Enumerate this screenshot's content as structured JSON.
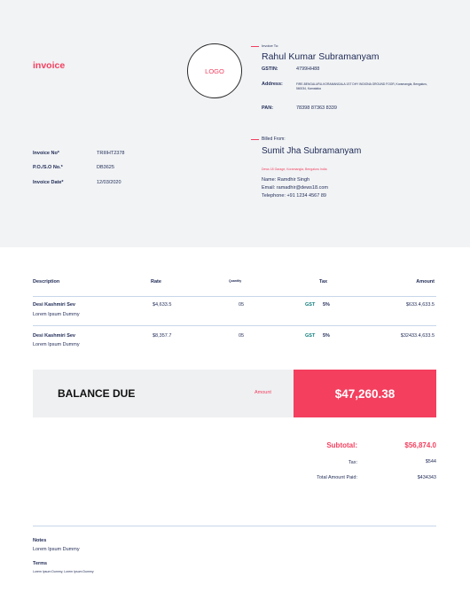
{
  "header": {
    "title": "invoice",
    "logo_text": "LOGO",
    "invoice_to": {
      "label": "Invoice To:",
      "name": "Rahul Kumar Subramanyam",
      "gstin_label": "GSTIN:",
      "gstin_value": "4799HH88",
      "address_label": "Address:",
      "address_value": "FIRE-BENGALURU-KORAMANGALA 1ST DHY INDIONA GROUND FOOR, Koramangla, Bengaluru, 560034, Karnataka",
      "pan_label": "PAN:",
      "pan_value": "78398 87363 8339"
    },
    "billed_from": {
      "label": "Billed From:",
      "name": "Sumit Jha Subramanyam",
      "address": "Dews 18 Garage, Koramangla, Bengaluru India",
      "contact_name": "Name: Ramdhir Singh",
      "email": "Email: ramadhir@dews18.com",
      "phone": "Telephone: +91 1234 4567 89"
    },
    "meta": {
      "invoice_no_label": "Invoice No*",
      "invoice_no": "TRIIIHT2378",
      "po_label": "P.O./S.O No.*",
      "po": "DB3625",
      "date_label": "Invoice Date*",
      "date": "12/03/2020"
    }
  },
  "table": {
    "headers": {
      "description": "Description",
      "rate": "Rate",
      "quantity": "Quantity",
      "tax": "Tax",
      "amount": "Amount"
    },
    "rows": [
      {
        "title": "Desi Kashmiri Sev",
        "subtitle": "Lorem Ipsum Dummy",
        "rate": "$4,633.5",
        "qty": "05",
        "tax_label": "GST",
        "tax_pct": "5%",
        "amount": "$633.4,633.5"
      },
      {
        "title": "Desi Kashmiri Sev",
        "subtitle": "Lorem Ipsum Dummy",
        "rate": "$8,357.7",
        "qty": "05",
        "tax_label": "GST",
        "tax_pct": "5%",
        "amount": "$32433.4,633.5"
      }
    ]
  },
  "balance": {
    "label": "BALANCE DUE",
    "amount_label": "Amount",
    "amount": "$47,260.38"
  },
  "totals": {
    "subtotal_label": "Subtotal:",
    "subtotal": "$56,874.0",
    "tax_label": "Tax:",
    "tax": "$544",
    "paid_label": "Total Amount Paid:",
    "paid": "$434343"
  },
  "footer": {
    "notes_label": "Notes",
    "notes": "Lorem Ipsum Dummy",
    "terms_label": "Terms",
    "terms": "Lorem Ipsum Dummy, Lorem Ipsum Dummy"
  },
  "colors": {
    "accent": "#f43f5e",
    "navy": "#1f2a55",
    "header_bg": "#f1f3f5",
    "tax_label": "#0f7b7b"
  }
}
